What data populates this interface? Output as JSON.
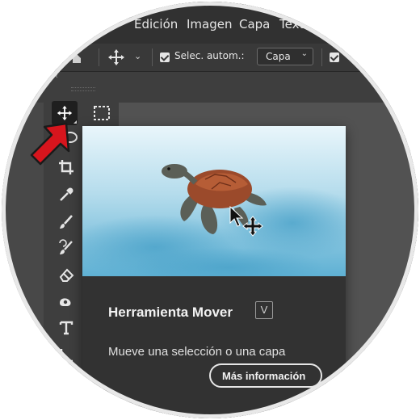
{
  "menubar": {
    "items": [
      "Edición",
      "Imagen",
      "Capa",
      "Texto"
    ]
  },
  "options_bar": {
    "auto_select_label": "Selec. autom.:",
    "auto_select_checked": true,
    "target_value": "Capa",
    "second_checkbox_checked": true
  },
  "tools": [
    {
      "name": "move-tool",
      "active": true
    },
    {
      "name": "marquee-tool"
    },
    {
      "name": "lasso-tool"
    },
    {
      "name": "crop-tool"
    },
    {
      "name": "eyedropper-tool"
    },
    {
      "name": "brush-tool"
    },
    {
      "name": "clone-stamp-tool"
    },
    {
      "name": "eraser-tool"
    },
    {
      "name": "blur-tool"
    },
    {
      "name": "type-tool"
    },
    {
      "name": "path-selection-tool"
    }
  ],
  "tooltip": {
    "title": "Herramienta Mover",
    "shortcut": "V",
    "description": "Mueve una selección o una capa",
    "more_button": "Más información"
  },
  "colors": {
    "annotation_arrow": "#d7151d",
    "menubar_bg": "#313131",
    "panel_bg": "#3e3e3e",
    "tooltip_bg": "#323232"
  }
}
